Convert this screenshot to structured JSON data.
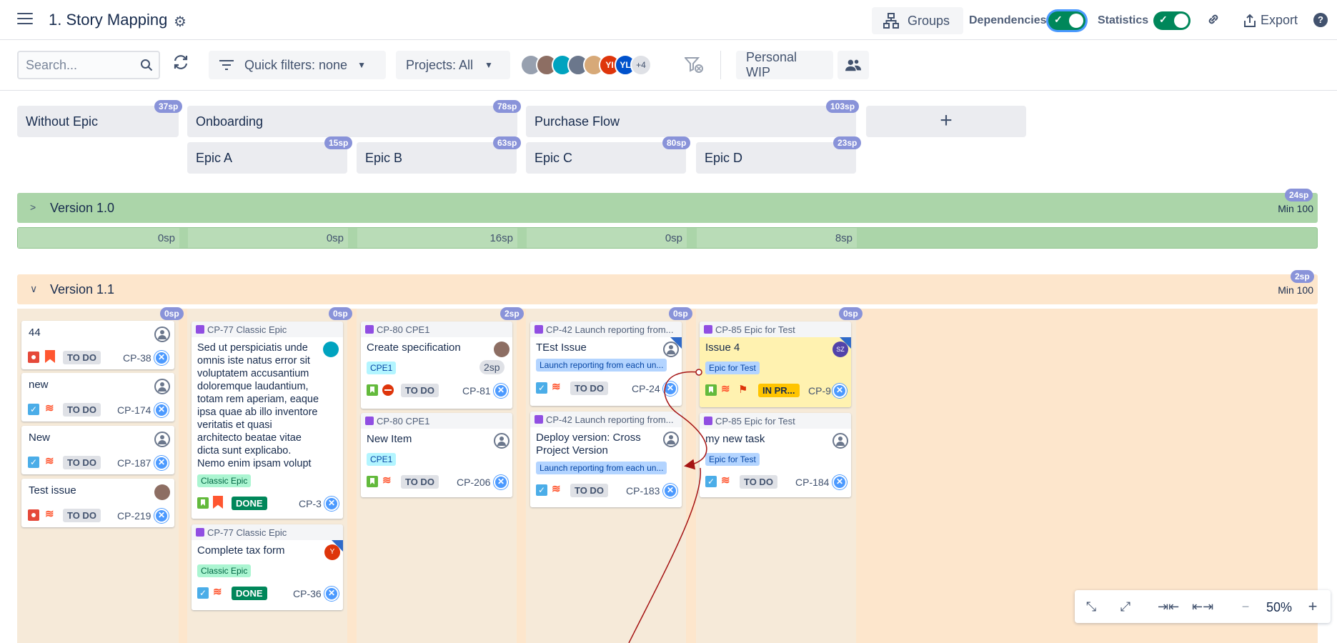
{
  "header": {
    "title": "1. Story Mapping",
    "groups_label": "Groups",
    "dependencies_label": "Dependencies",
    "statistics_label": "Statistics",
    "export_label": "Export"
  },
  "filters": {
    "search_placeholder": "Search...",
    "quick_filters_label": "Quick filters: none",
    "projects_label": "Projects: All",
    "avatars": [
      {
        "initials": "",
        "color": "#97a0af"
      },
      {
        "initials": "",
        "color": "#8d6e63"
      },
      {
        "initials": "",
        "color": "#00a3bf"
      },
      {
        "initials": "",
        "color": "#6b778c"
      },
      {
        "initials": "",
        "color": "#d7a978"
      },
      {
        "initials": "YI",
        "color": "#de350b"
      },
      {
        "initials": "YL",
        "color": "#0052cc"
      }
    ],
    "more_avatars": "+4",
    "personal_wip_label": "Personal WIP"
  },
  "epics": {
    "top": [
      {
        "name": "Without Epic",
        "sp": "37sp"
      },
      {
        "name": "Onboarding",
        "sp": "78sp"
      },
      {
        "name": "Purchase Flow",
        "sp": "103sp"
      }
    ],
    "sub": [
      {
        "name": "Epic A",
        "sp": "15sp"
      },
      {
        "name": "Epic B",
        "sp": "63sp"
      },
      {
        "name": "Epic C",
        "sp": "80sp"
      },
      {
        "name": "Epic D",
        "sp": "23sp"
      }
    ],
    "add_label": "+"
  },
  "versions": [
    {
      "name": "Version 1.0",
      "sp": "24sp",
      "min": "Min 100",
      "column_sp": [
        "0sp",
        "0sp",
        "16sp",
        "0sp",
        "8sp"
      ]
    },
    {
      "name": "Version 1.1",
      "sp": "2sp",
      "min": "Min 100",
      "column_sp": [
        "0sp",
        "0sp",
        "2sp",
        "0sp",
        "0sp"
      ]
    }
  ],
  "cards": {
    "c1": {
      "title": "44",
      "status": "TO DO",
      "id": "CP-38"
    },
    "c2": {
      "title": "new",
      "status": "TO DO",
      "id": "CP-174"
    },
    "c3": {
      "title": "New",
      "status": "TO DO",
      "id": "CP-187"
    },
    "c4": {
      "title": "Test issue",
      "status": "TO DO",
      "id": "CP-219"
    },
    "c5": {
      "epic": "CP-77 Classic Epic",
      "title_lines": [
        "Sed ut perspiciatis unde",
        "omnis iste natus error sit",
        "voluptatem accusantium",
        "doloremque laudantium,",
        "totam rem aperiam, eaque",
        "ipsa quae ab illo inventore",
        "veritatis et quasi",
        "architecto beatae vitae",
        "dicta sunt explicabo.",
        "Nemo enim ipsam volupt"
      ],
      "chip": "Classic Epic",
      "status": "DONE",
      "id": "CP-3"
    },
    "c6": {
      "epic": "CP-77 Classic Epic",
      "title": "Complete tax form",
      "chip": "Classic Epic",
      "status": "DONE",
      "id": "CP-36",
      "avatar": "Y"
    },
    "c7": {
      "epic": "CP-80 CPE1",
      "title": "Create specification",
      "chip": "CPE1",
      "estimate": "2sp",
      "status": "TO DO",
      "id": "CP-81"
    },
    "c8": {
      "epic": "CP-80 CPE1",
      "title": "New Item",
      "chip": "CPE1",
      "status": "TO DO",
      "id": "CP-206"
    },
    "c9": {
      "epic": "CP-42 Launch reporting from...",
      "title": "TEst Issue",
      "chip": "Launch reporting from each un...",
      "status": "TO DO",
      "id": "CP-24"
    },
    "c10": {
      "epic": "CP-42 Launch reporting from...",
      "title_lines": [
        "Deploy version: Cross",
        "Project Version"
      ],
      "chip": "Launch reporting from each un...",
      "status": "TO DO",
      "id": "CP-183"
    },
    "c11": {
      "epic": "CP-85 Epic for Test",
      "title": "Issue 4",
      "chip": "Epic for Test",
      "status": "IN PR...",
      "id": "CP-9",
      "avatar": "SZ"
    },
    "c12": {
      "epic": "CP-85 Epic for Test",
      "title": "my new task",
      "chip": "Epic for Test",
      "status": "TO DO",
      "id": "CP-184"
    }
  },
  "zoom": {
    "value": "50%"
  }
}
